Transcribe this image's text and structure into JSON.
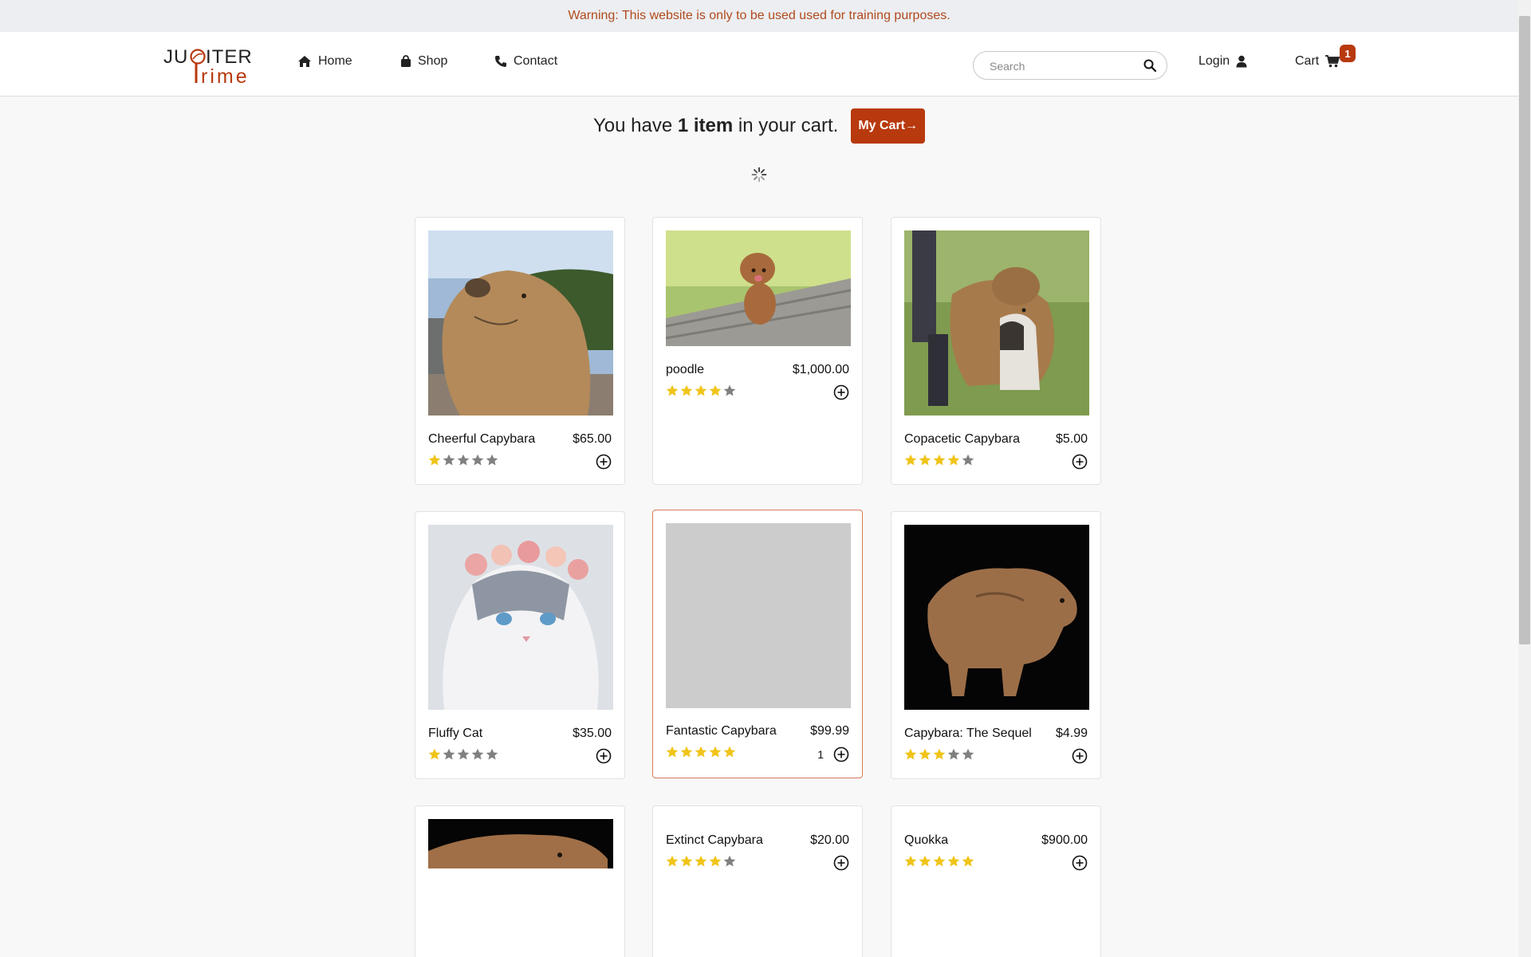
{
  "warning": {
    "text": "Warning: This website is only to be used used for training purposes."
  },
  "brand": {
    "logo_text_top": "JUPITER",
    "logo_text_bottom": "Prime",
    "accent_color": "#b8390e"
  },
  "nav": {
    "home": "Home",
    "shop": "Shop",
    "contact": "Contact"
  },
  "search": {
    "placeholder": "Search",
    "value": ""
  },
  "account": {
    "login": "Login",
    "cart": "Cart",
    "cart_count": "1"
  },
  "cart_summary": {
    "prefix": "You have",
    "count_label": "1 item",
    "suffix": "in your cart.",
    "button": "My Cart→"
  },
  "products": [
    {
      "name": "Cheerful Capybara",
      "price": "$65.00",
      "rating": 1,
      "image": "capybara-closeup"
    },
    {
      "name": "poodle",
      "price": "$1,000.00",
      "rating": 4,
      "image": "poodle-on-steps"
    },
    {
      "name": "Copacetic Capybara",
      "price": "$5.00",
      "rating": 4,
      "image": "capybara-with-cat"
    },
    {
      "name": "Fluffy Cat",
      "price": "$35.00",
      "rating": 1,
      "image": "cat-flower-crown"
    },
    {
      "name": "Fantastic Capybara",
      "price": "$99.99",
      "rating": 5,
      "image": "placeholder-gray",
      "quantity": "1"
    },
    {
      "name": "Capybara: The Sequel",
      "price": "$4.99",
      "rating": 3,
      "image": "capybara-black-background"
    },
    {
      "name": "",
      "price": "",
      "rating": 0,
      "image": "capybara-partial"
    },
    {
      "name": "Extinct Capybara",
      "price": "$20.00",
      "rating": 4,
      "image": ""
    },
    {
      "name": "Quokka",
      "price": "$900.00",
      "rating": 5,
      "image": ""
    }
  ]
}
